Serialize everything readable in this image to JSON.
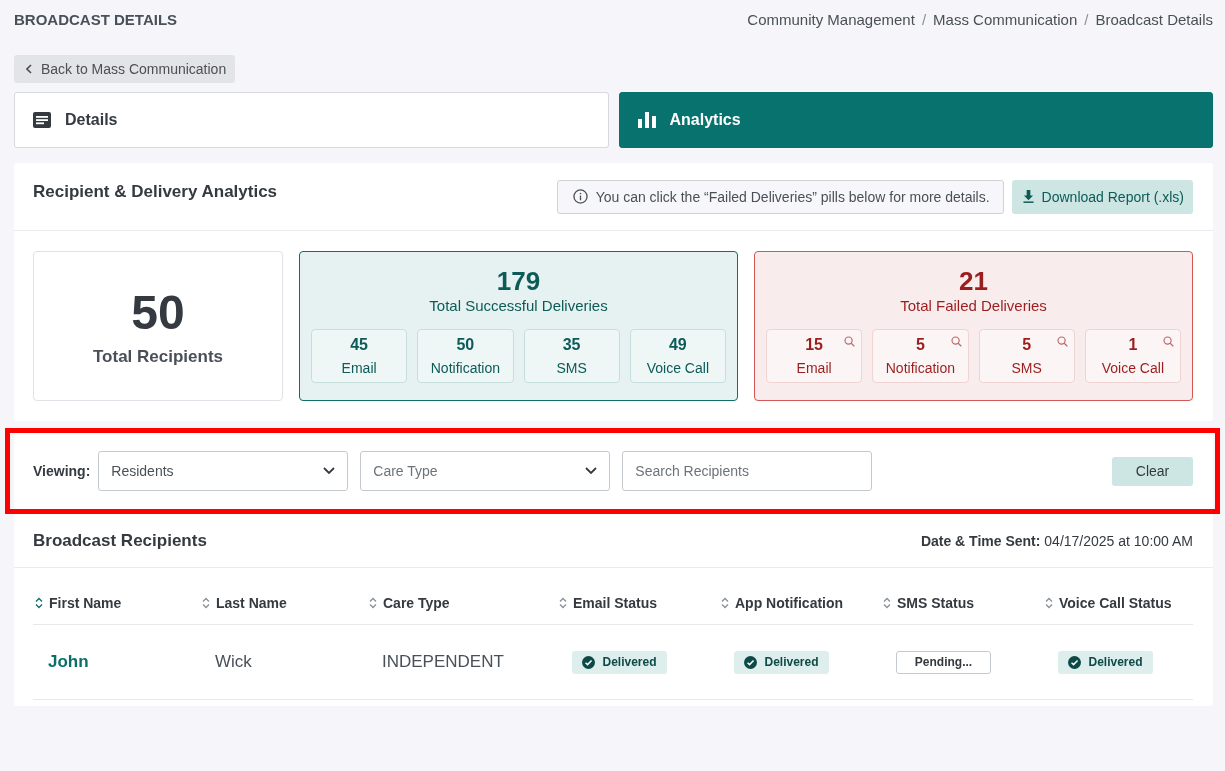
{
  "page_title": "BROADCAST DETAILS",
  "breadcrumb": {
    "separator": "/",
    "items": [
      "Community Management",
      "Mass Communication",
      "Broadcast Details"
    ]
  },
  "back_button": "Back to Mass Communication",
  "tabs": [
    {
      "label": "Details",
      "selected": false
    },
    {
      "label": "Analytics",
      "selected": true
    }
  ],
  "analytics": {
    "title": "Recipient & Delivery Analytics",
    "info_note": "You can click the “Failed Deliveries” pills below for more details.",
    "download_button": "Download Report (.xls)",
    "stat_cards": [
      {
        "kind": "total",
        "value": "50",
        "label": "Total Recipients"
      },
      {
        "kind": "success",
        "value": "179",
        "label": "Total Successful Deliveries",
        "channels": [
          {
            "count": "45",
            "label": "Email"
          },
          {
            "count": "50",
            "label": "Notification"
          },
          {
            "count": "35",
            "label": "SMS"
          },
          {
            "count": "49",
            "label": "Voice Call"
          }
        ]
      },
      {
        "kind": "failed",
        "value": "21",
        "label": "Total Failed Deliveries",
        "channels": [
          {
            "count": "15",
            "label": "Email"
          },
          {
            "count": "5",
            "label": "Notification"
          },
          {
            "count": "5",
            "label": "SMS"
          },
          {
            "count": "1",
            "label": "Voice Call"
          }
        ]
      }
    ]
  },
  "filters": {
    "highlighted": true,
    "viewing_label": "Viewing:",
    "viewing_select": {
      "value": "Residents"
    },
    "care_type_select": {
      "placeholder": "Care Type"
    },
    "search": {
      "placeholder": "Search Recipients"
    },
    "clear_button": "Clear"
  },
  "recipients": {
    "title": "Broadcast Recipients",
    "sent_info": "**Date & Time Sent:** 04/17/2025 at 10:00 AM",
    "table": {
      "columns": [
        {
          "label": "First Name",
          "sorted": true
        },
        {
          "label": "Last Name",
          "sorted": false
        },
        {
          "label": "Care Type",
          "sorted": false
        },
        {
          "label": "Email Status",
          "sorted": false
        },
        {
          "label": "App Notification",
          "sorted": false
        },
        {
          "label": "SMS Status",
          "sorted": false
        },
        {
          "label": "Voice Call Status",
          "sorted": false
        }
      ],
      "rows": [
        {
          "first_name": "John",
          "last_name": "Wick",
          "care_type": "INDEPENDENT",
          "statuses": [
            {
              "kind": "delivered",
              "label": "Delivered"
            },
            {
              "kind": "delivered",
              "label": "Delivered"
            },
            {
              "kind": "pending",
              "label": "Pending..."
            },
            {
              "kind": "delivered",
              "label": "Delivered"
            }
          ]
        }
      ]
    }
  }
}
